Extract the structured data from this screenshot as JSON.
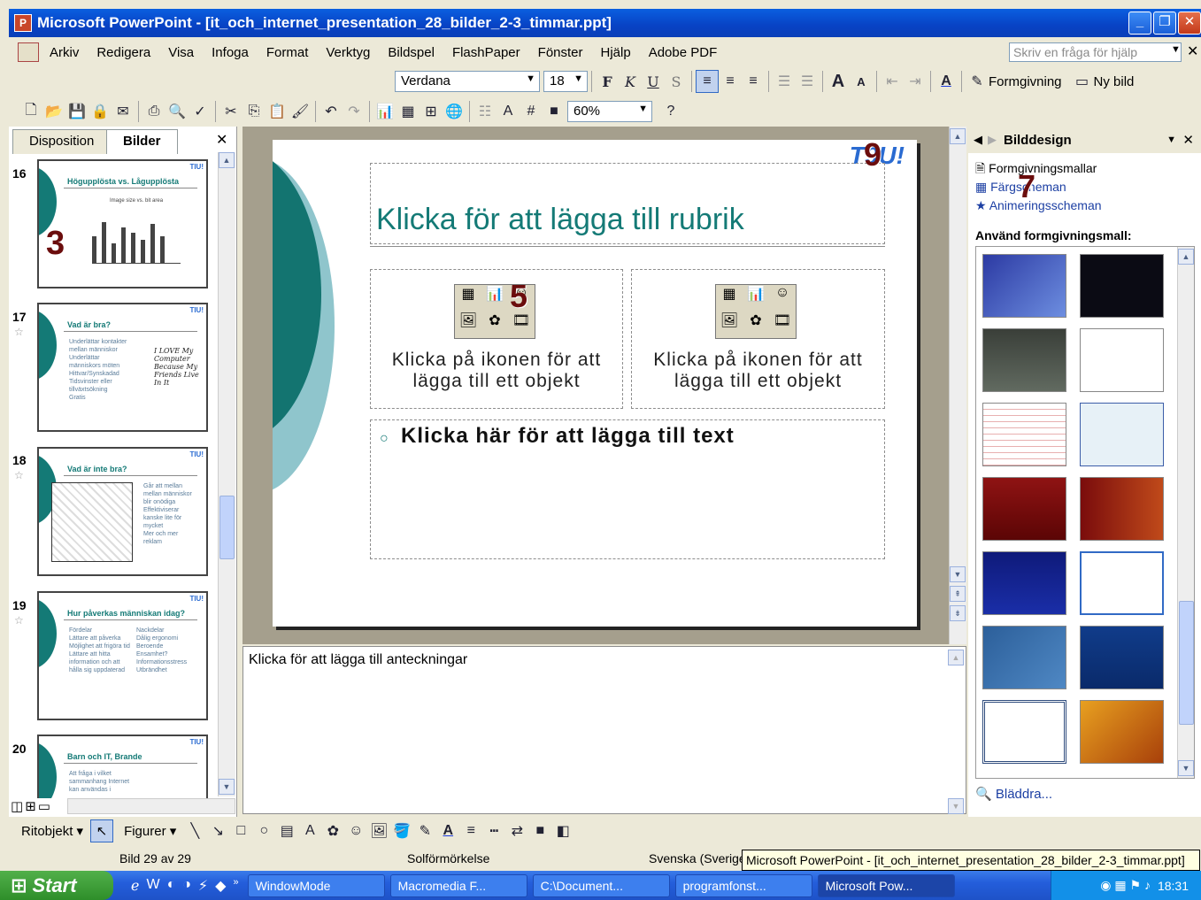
{
  "window": {
    "title": "Microsoft PowerPoint - [it_och_internet_presentation_28_bilder_2-3_timmar.ppt]",
    "icon": "powerpoint-icon"
  },
  "menu": [
    "Arkiv",
    "Redigera",
    "Visa",
    "Infoga",
    "Format",
    "Verktyg",
    "Bildspel",
    "FlashPaper",
    "Fönster",
    "Hjälp",
    "Adobe PDF"
  ],
  "help": {
    "placeholder": "Skriv en fråga för hjälp"
  },
  "format_toolbar": {
    "font": "Verdana",
    "size": "18",
    "bold": "F",
    "italic": "K",
    "underline": "U",
    "shadow": "S",
    "design": "Formgivning",
    "new_slide": "Ny bild"
  },
  "std_toolbar": {
    "zoom": "60%"
  },
  "left_panel": {
    "tab_outline": "Disposition",
    "tab_slides": "Bilder",
    "slides": [
      {
        "num": "16",
        "title": "Högupplösta vs. Lågupplösta",
        "chart_title": "Image size vs. bit area"
      },
      {
        "num": "17",
        "title": "Vad är bra?",
        "body": [
          "Underlättar kontakter mellan människor",
          "Underlättar människors möten",
          "Hittvar/Synskadad",
          "Tidsvinster eller tillväxtsökning",
          "Gratis"
        ],
        "art": "I LOVE My Computer Because My Friends Live In It"
      },
      {
        "num": "18",
        "title": "Vad är inte bra?",
        "body": [
          "Går att mellan mellan människor blir onödiga",
          "Effektiviserar kanske lite för mycket",
          "Mer och mer reklam"
        ]
      },
      {
        "num": "19",
        "title": "Hur påverkas människan idag?",
        "col1_head": "Fördelar",
        "col2_head": "Nackdelar",
        "col1": [
          "Lättare att påverka",
          "Möjlighet att frigöra tid",
          "Lättare att hitta information och att hålla sig uppdaterad"
        ],
        "col2": [
          "Dålig ergonomi",
          "Beroende",
          "Ensamhet?",
          "Informationsstress",
          "Utbrändhet"
        ]
      },
      {
        "num": "20",
        "title": "Barn och IT, Brande",
        "body": [
          "Att fråga i vilket sammanhang Internet kan användas i"
        ]
      }
    ],
    "badge": "3"
  },
  "slide": {
    "title_ph": "Klicka för att lägga till rubrik",
    "obj_ph": "Klicka på ikonen för att lägga till ett objekt",
    "text_ph": "Klicka här för att lägga till text",
    "logo": "T9U!",
    "badge_logo": "9",
    "badge_icon": "5"
  },
  "notes": {
    "placeholder": "Klicka för att lägga till anteckningar"
  },
  "right_panel": {
    "title": "Bilddesign",
    "links": [
      "Formgivningsmallar",
      "Färgscheman",
      "Animeringsscheman"
    ],
    "apply_label": "Använd formgivningsmall:",
    "browse": "Bläddra...",
    "badge": "7"
  },
  "drawing_toolbar": {
    "draw": "Ritobjekt",
    "shapes": "Figurer"
  },
  "status": {
    "slide": "Bild 29 av 29",
    "design": "Solförmörkelse",
    "lang": "Svenska (Sverige)"
  },
  "tooltip": "Microsoft PowerPoint - [it_och_internet_presentation_28_bilder_2-3_timmar.ppt]",
  "taskbar": {
    "start": "Start",
    "tasks": [
      "WindowMode",
      "Macromedia F...",
      "C:\\Document...",
      "programfonst...",
      "Microsoft Pow..."
    ],
    "time": "18:31"
  }
}
